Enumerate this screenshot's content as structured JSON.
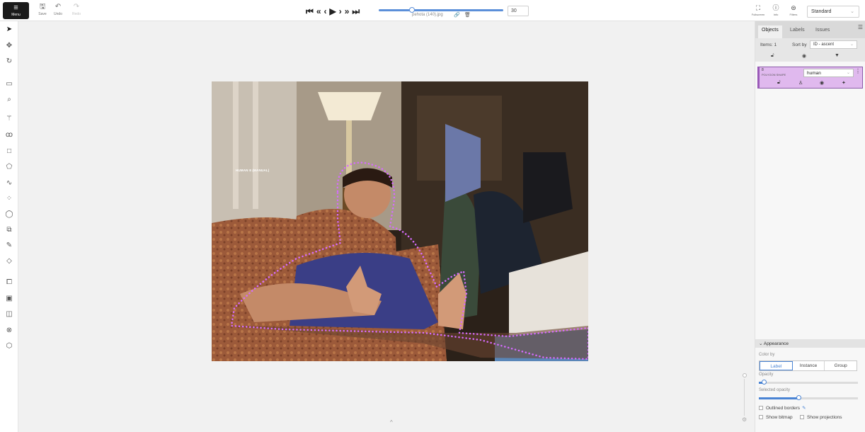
{
  "topbar": {
    "menu_label": "Menu",
    "menu_glyph": "≡",
    "save_label": "Save",
    "undo_label": "Undo",
    "redo_label": "Redo",
    "save_glyph": "🖫",
    "undo_glyph": "↶",
    "redo_glyph": "↷",
    "player": {
      "first": "⏮",
      "fast_back": "«",
      "back": "‹",
      "play": "▶",
      "forward": "›",
      "fast_forward": "»",
      "last": "⏭"
    },
    "filename": "pehota (140).jpg",
    "frame_value": "30",
    "frame_progress_percent": 24,
    "fullscreen_label": "Fullscreen",
    "info_label": "Info",
    "filters_label": "Filters",
    "workspace": "Standard"
  },
  "left_tools": [
    {
      "name": "cursor-icon",
      "glyph": "➤"
    },
    {
      "name": "move-icon",
      "glyph": "✥"
    },
    {
      "name": "rotate-icon",
      "glyph": "↻"
    },
    {
      "name": "fit-image-icon",
      "glyph": "▭"
    },
    {
      "name": "zoom-region-icon",
      "glyph": "⌕"
    },
    {
      "name": "magic-wand-icon",
      "glyph": "⚚"
    },
    {
      "name": "ai-tools-icon",
      "glyph": "ꝏ"
    },
    {
      "name": "rectangle-icon",
      "glyph": "□"
    },
    {
      "name": "polygon-icon",
      "glyph": "⬠"
    },
    {
      "name": "polyline-icon",
      "glyph": "∿"
    },
    {
      "name": "points-icon",
      "glyph": "⁘"
    },
    {
      "name": "ellipse-icon",
      "glyph": "◯"
    },
    {
      "name": "cuboid-icon",
      "glyph": "⧉"
    },
    {
      "name": "brush-icon",
      "glyph": "✎"
    },
    {
      "name": "tag-icon",
      "glyph": "◇"
    },
    {
      "name": "merge-icon",
      "glyph": "⧠"
    },
    {
      "name": "group-icon",
      "glyph": "▣"
    },
    {
      "name": "split-icon",
      "glyph": "◫"
    },
    {
      "name": "join-icon",
      "glyph": "⊗"
    },
    {
      "name": "slice-icon",
      "glyph": "⬡"
    }
  ],
  "canvas": {
    "object_label": "HUMAN 8 (MANUAL)",
    "caret": "^",
    "gear": "⚙"
  },
  "sidebar": {
    "tabs": [
      "Objects",
      "Labels",
      "Issues"
    ],
    "items_label": "Items: 1",
    "sort_label": "Sort by",
    "sort_value": "ID - ascent",
    "object": {
      "id": "8",
      "type": "POLYGON SHAPE",
      "label": "human",
      "menu": "⋮"
    },
    "appearance": {
      "title": "Appearance",
      "color_by_label": "Color by",
      "color_options": [
        "Label",
        "Instance",
        "Group"
      ],
      "selected_color_option": "Label",
      "opacity_label": "Opacity",
      "opacity_value": 5,
      "selected_opacity_label": "Selected opacity",
      "selected_opacity_value": 40,
      "outlined_borders_label": "Outlined borders",
      "show_bitmap_label": "Show bitmap",
      "show_projections_label": "Show projections"
    }
  },
  "colors": {
    "accent": "#4a84d4",
    "polygon": "#d66bff",
    "card_bg": "#e0b9ee"
  }
}
